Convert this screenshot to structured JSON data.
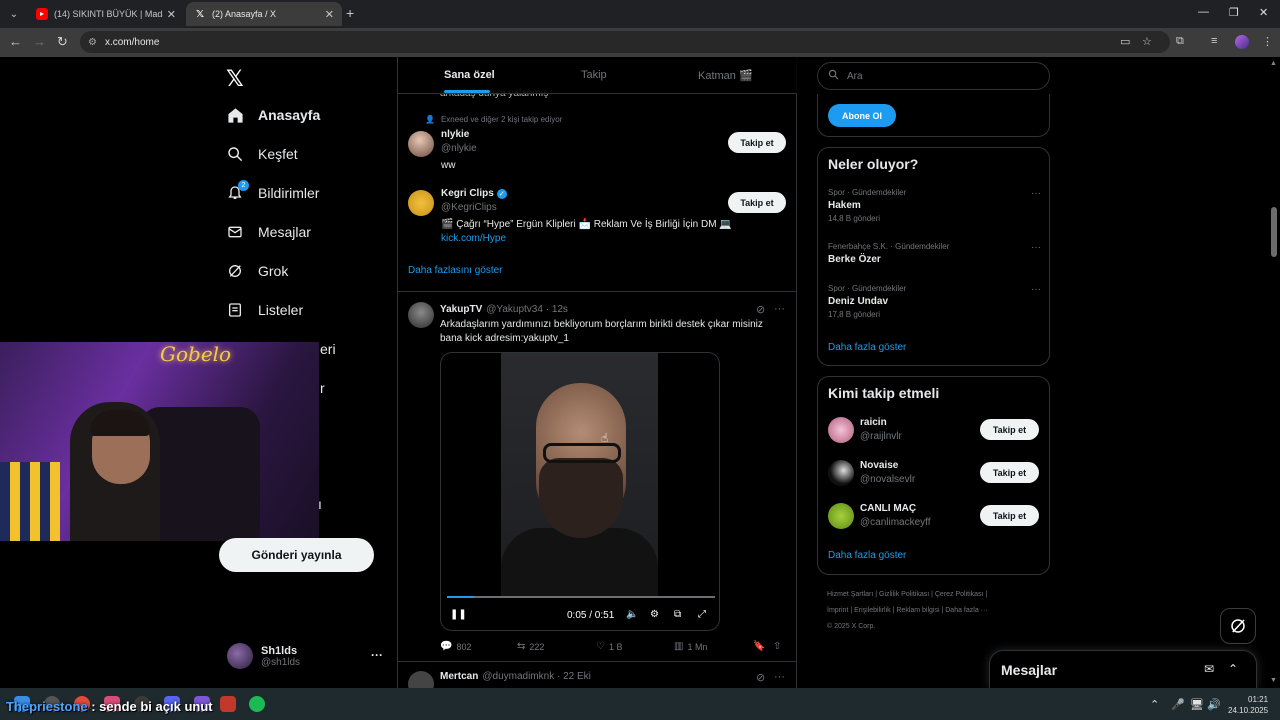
{
  "browser": {
    "tabs": [
      {
        "title": "(14) SIKINTI BÜYÜK | Madara O",
        "favicon": "youtube-icon",
        "active": false
      },
      {
        "title": "(2) Anasayfa / X",
        "favicon": "x-icon",
        "active": true
      }
    ],
    "url": "x.com/home",
    "accent": "#1d9bf0"
  },
  "sidebar": {
    "items": [
      {
        "label": "Anasayfa",
        "icon": "home-icon",
        "active": true
      },
      {
        "label": "Keşfet",
        "icon": "search-icon"
      },
      {
        "label": "Bildirimler",
        "icon": "bell-icon",
        "badge": "2"
      },
      {
        "label": "Mesajlar",
        "icon": "mail-icon"
      },
      {
        "label": "Grok",
        "icon": "grok-icon"
      },
      {
        "label": "Listeler",
        "icon": "list-icon"
      }
    ],
    "clipped": {
      "a": "eri",
      "b": "r",
      "c": "ı"
    },
    "post_button": "Gönderi yayınla",
    "account": {
      "name": "Sh1lds",
      "handle": "@sh1lds"
    }
  },
  "webcam": {
    "neon_text": "Gobelo"
  },
  "feed": {
    "tabs": [
      "Sana özel",
      "Takip",
      "Katman 🎬"
    ],
    "clipped_text": "arkadaş dünya yalanmış",
    "suggestion_context": "Exneed ve diğer 2 kişi takip ediyor",
    "suggested": [
      {
        "name": "nlykie",
        "handle": "@nlykie",
        "bio": "ww",
        "button": "Takip et"
      },
      {
        "name": "Kegri Clips",
        "handle": "@KegriClips",
        "bio": "🎬 Çağrı “Hype” Ergün Klipleri 📩 Reklam Ve İş Birliği İçin DM 💻",
        "link": "kick.com/Hype",
        "button": "Takip et",
        "verified": true
      }
    ],
    "show_more": "Daha fazlasını göster",
    "post": {
      "name": "YakupTV",
      "handle": "@Yakuptv34",
      "time": "12s",
      "text": "Arkadaşlarım yardımınızı bekliyorum borçlarım birikti destek çıkar misiniz bana kick adresim:yakuptv_1",
      "video_time": "0:05 / 0:51",
      "video_progress": 0.1,
      "replies": "802",
      "reposts": "222",
      "likes": "1 B",
      "views": "1 Mn"
    },
    "post2": {
      "name": "Mertcan",
      "handle": "@duymadimknk",
      "time": "22 Eki"
    }
  },
  "right": {
    "search_placeholder": "Ara",
    "subscribe_button": "Abone Ol",
    "trends_title": "Neler oluyor?",
    "trends": [
      {
        "context": "Spor · Gündemdekiler",
        "title": "Hakem",
        "count": "14,8 B gönderi"
      },
      {
        "context": "Fenerbahçe S.K. · Gündemdekiler",
        "title": "Berke Özer",
        "count": ""
      },
      {
        "context": "Spor · Gündemdekiler",
        "title": "Deniz Undav",
        "count": "17,8 B gönderi"
      }
    ],
    "trends_more": "Daha fazla göster",
    "wtf_title": "Kimi takip etmeli",
    "who_to_follow": [
      {
        "name": "raicin",
        "handle": "@raijlnvlr",
        "button": "Takip et"
      },
      {
        "name": "Novaise",
        "handle": "@novalsevlr",
        "button": "Takip et"
      },
      {
        "name": "CANLI MAÇ",
        "handle": "@canlimackeyff",
        "button": "Takip et"
      }
    ],
    "wtf_more": "Daha fazla göster",
    "footer": {
      "l1": "Hizmet Şartları  |  Gizlilik Politikası  |  Çerez Politikası  |",
      "l2": "İmprint  |  Erişilebilirlik  |  Reklam bilgisi  |  Daha fazla ···",
      "l3": "© 2025 X Corp."
    },
    "messages_drawer": "Mesajlar"
  },
  "taskbar": {
    "ticker_user": "Thepriestone",
    "ticker_text": " : sende bi açık unut",
    "time": "01:21",
    "date": "24.10.2025"
  }
}
